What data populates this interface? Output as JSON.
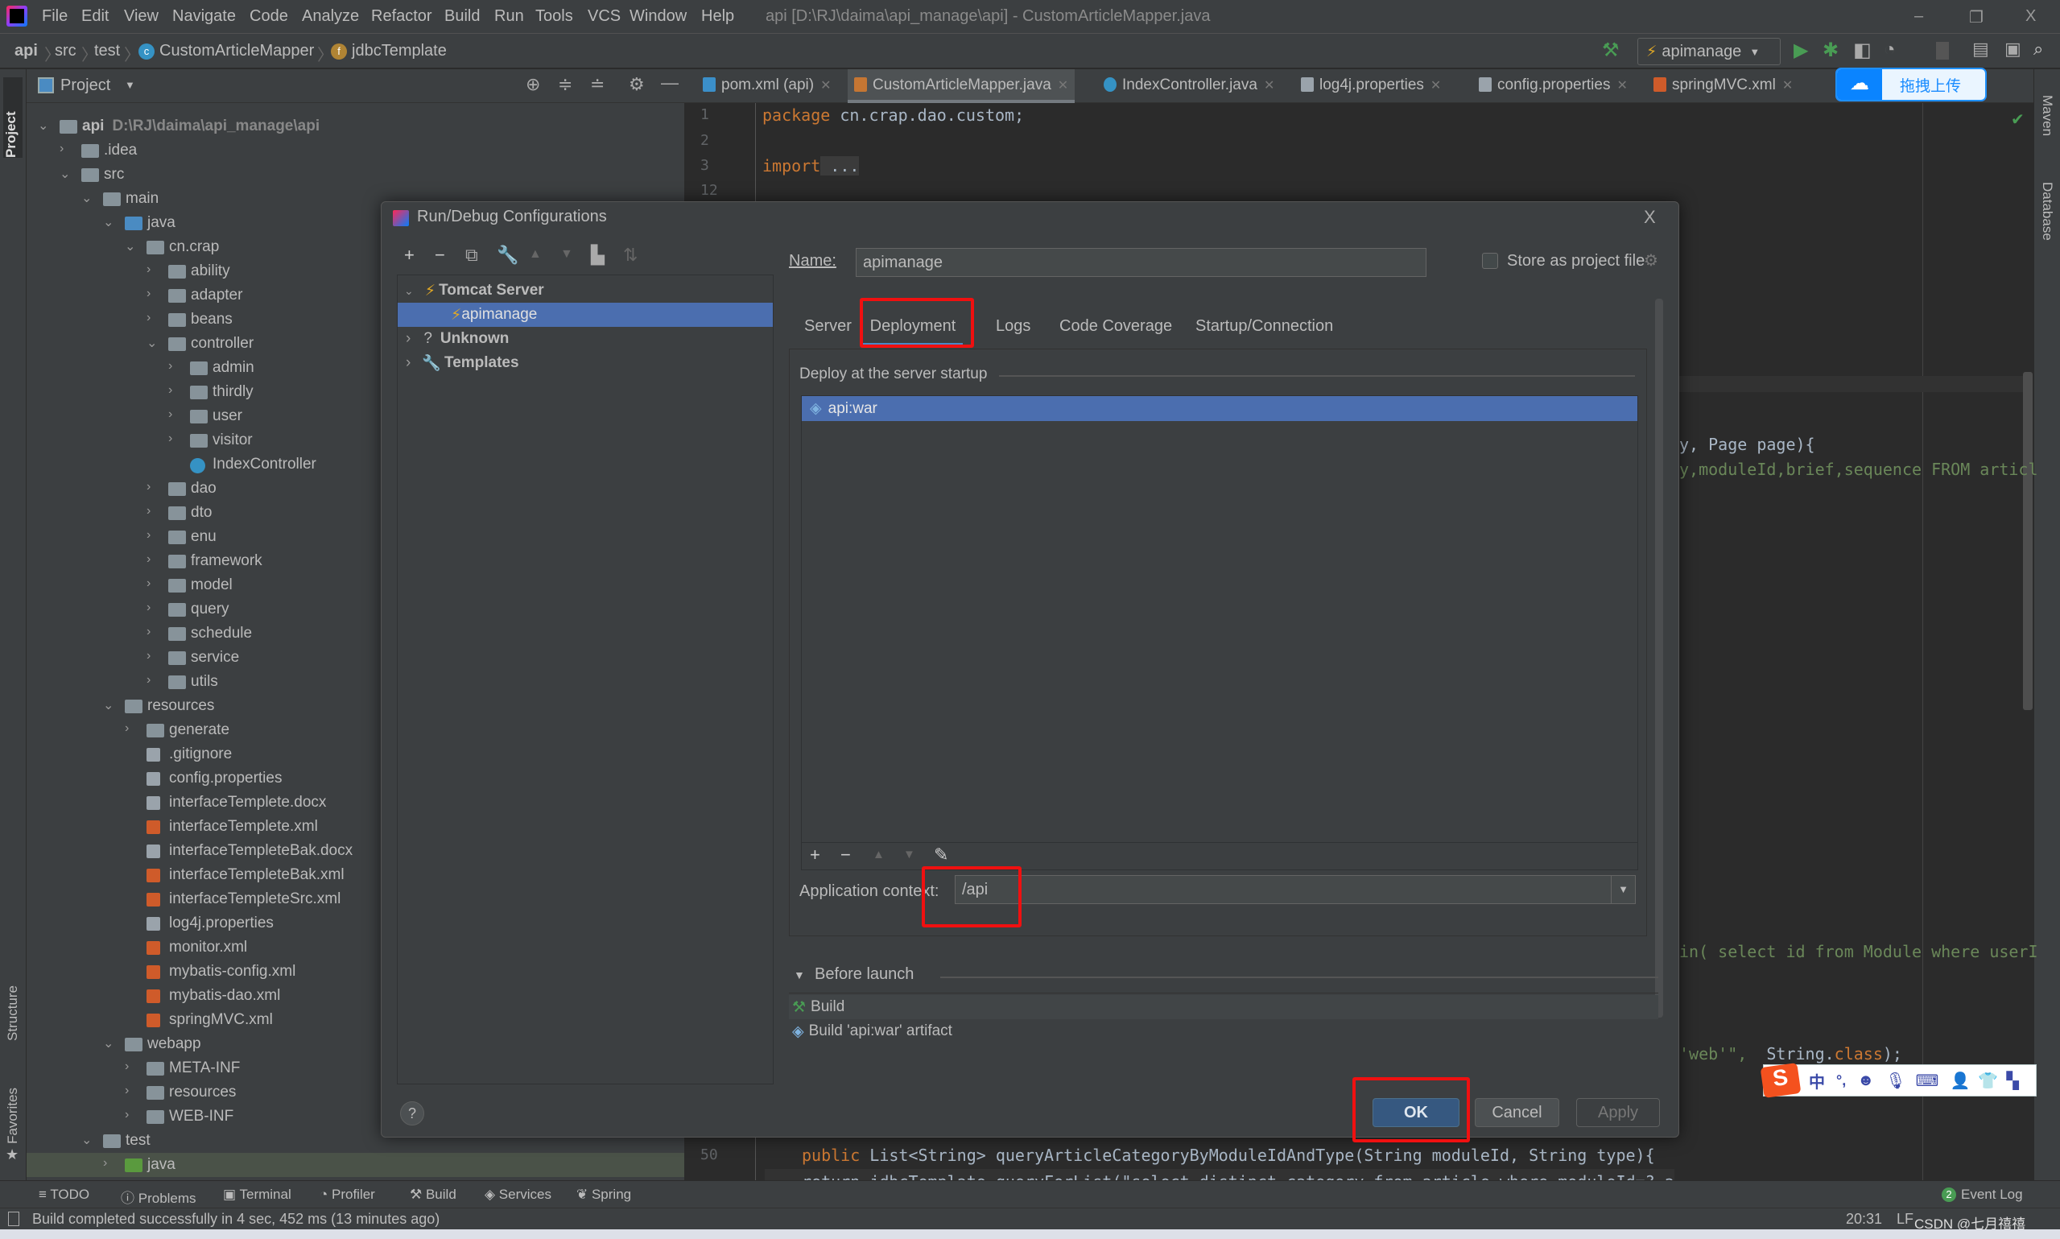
{
  "window": {
    "title": "api [D:\\RJ\\daima\\api_manage\\api] - CustomArticleMapper.java",
    "minimize": "–",
    "restore": "❐",
    "close": "X"
  },
  "menu": [
    "File",
    "Edit",
    "View",
    "Navigate",
    "Code",
    "Analyze",
    "Refactor",
    "Build",
    "Run",
    "Tools",
    "VCS",
    "Window",
    "Help"
  ],
  "breadcrumb": [
    "api",
    "src",
    "test",
    "CustomArticleMapper",
    "jdbcTemplate"
  ],
  "toolbar": {
    "run_config": "apimanage"
  },
  "upload_widget": {
    "label": "拖拽上传"
  },
  "left_stripe": {
    "project": "Project",
    "structure": "Structure",
    "favorites": "Favorites"
  },
  "right_stripe": {
    "maven": "Maven",
    "database": "Database"
  },
  "project_panel": {
    "title": "Project"
  },
  "tree": [
    {
      "label": "api",
      "hint": "D:\\RJ\\daima\\api_manage\\api",
      "level": 0,
      "exp": true,
      "type": "module"
    },
    {
      "label": ".idea",
      "level": 1,
      "exp": false,
      "type": "folder"
    },
    {
      "label": "src",
      "level": 1,
      "exp": true,
      "type": "folder"
    },
    {
      "label": "main",
      "level": 2,
      "exp": true,
      "type": "folder"
    },
    {
      "label": "java",
      "level": 3,
      "exp": true,
      "type": "src"
    },
    {
      "label": "cn.crap",
      "level": 4,
      "exp": true,
      "type": "folder"
    },
    {
      "label": "ability",
      "level": 5,
      "exp": false,
      "type": "folder"
    },
    {
      "label": "adapter",
      "level": 5,
      "exp": false,
      "type": "folder"
    },
    {
      "label": "beans",
      "level": 5,
      "exp": false,
      "type": "folder"
    },
    {
      "label": "controller",
      "level": 5,
      "exp": true,
      "type": "folder"
    },
    {
      "label": "admin",
      "level": 6,
      "exp": false,
      "type": "folder"
    },
    {
      "label": "thirdly",
      "level": 6,
      "exp": false,
      "type": "folder"
    },
    {
      "label": "user",
      "level": 6,
      "exp": false,
      "type": "folder"
    },
    {
      "label": "visitor",
      "level": 6,
      "exp": false,
      "type": "folder"
    },
    {
      "label": "IndexController",
      "level": 6,
      "exp": null,
      "type": "class"
    },
    {
      "label": "dao",
      "level": 5,
      "exp": false,
      "type": "folder"
    },
    {
      "label": "dto",
      "level": 5,
      "exp": false,
      "type": "folder"
    },
    {
      "label": "enu",
      "level": 5,
      "exp": false,
      "type": "folder"
    },
    {
      "label": "framework",
      "level": 5,
      "exp": false,
      "type": "folder"
    },
    {
      "label": "model",
      "level": 5,
      "exp": false,
      "type": "folder"
    },
    {
      "label": "query",
      "level": 5,
      "exp": false,
      "type": "folder"
    },
    {
      "label": "schedule",
      "level": 5,
      "exp": false,
      "type": "folder"
    },
    {
      "label": "service",
      "level": 5,
      "exp": false,
      "type": "folder"
    },
    {
      "label": "utils",
      "level": 5,
      "exp": false,
      "type": "folder"
    },
    {
      "label": "resources",
      "level": 3,
      "exp": true,
      "type": "res"
    },
    {
      "label": "generate",
      "level": 4,
      "exp": false,
      "type": "folder"
    },
    {
      "label": ".gitignore",
      "level": 4,
      "exp": null,
      "type": "file"
    },
    {
      "label": "config.properties",
      "level": 4,
      "exp": null,
      "type": "props"
    },
    {
      "label": "interfaceTemplete.docx",
      "level": 4,
      "exp": null,
      "type": "file"
    },
    {
      "label": "interfaceTemplete.xml",
      "level": 4,
      "exp": null,
      "type": "xml"
    },
    {
      "label": "interfaceTempleteBak.docx",
      "level": 4,
      "exp": null,
      "type": "file"
    },
    {
      "label": "interfaceTempleteBak.xml",
      "level": 4,
      "exp": null,
      "type": "xml"
    },
    {
      "label": "interfaceTempleteSrc.xml",
      "level": 4,
      "exp": null,
      "type": "xml"
    },
    {
      "label": "log4j.properties",
      "level": 4,
      "exp": null,
      "type": "props"
    },
    {
      "label": "monitor.xml",
      "level": 4,
      "exp": null,
      "type": "xml"
    },
    {
      "label": "mybatis-config.xml",
      "level": 4,
      "exp": null,
      "type": "xml"
    },
    {
      "label": "mybatis-dao.xml",
      "level": 4,
      "exp": null,
      "type": "xml"
    },
    {
      "label": "springMVC.xml",
      "level": 4,
      "exp": null,
      "type": "xml"
    },
    {
      "label": "webapp",
      "level": 3,
      "exp": true,
      "type": "web"
    },
    {
      "label": "META-INF",
      "level": 4,
      "exp": false,
      "type": "folder"
    },
    {
      "label": "resources",
      "level": 4,
      "exp": false,
      "type": "folder"
    },
    {
      "label": "WEB-INF",
      "level": 4,
      "exp": false,
      "type": "folder"
    },
    {
      "label": "test",
      "level": 2,
      "exp": true,
      "type": "folder"
    },
    {
      "label": "java",
      "level": 3,
      "exp": false,
      "type": "test",
      "selected": true
    },
    {
      "label": "resources",
      "level": 3,
      "exp": false,
      "type": "folder"
    }
  ],
  "editor_tabs": [
    {
      "label": "pom.xml (api)",
      "icon": "maven-icon"
    },
    {
      "label": "CustomArticleMapper.java",
      "icon": "java-file-icon",
      "active": true
    },
    {
      "label": "IndexController.java",
      "icon": "class-icon"
    },
    {
      "label": "log4j.properties",
      "icon": "properties-icon"
    },
    {
      "label": "config.properties",
      "icon": "properties-icon"
    },
    {
      "label": "springMVC.xml",
      "icon": "spring-xml-icon"
    }
  ],
  "code": {
    "line_numbers": [
      "1",
      "2",
      "3",
      "12",
      "50",
      "51"
    ],
    "l1_kw": "package",
    "l1_rest": " cn.crap.dao.custom;",
    "l3_kw": "import",
    "l3_rest": " ...",
    "r1": "y, Page page){",
    "r2": "y,moduleId,brief,sequence FROM articl",
    "r3": "in( select id from Module where userI",
    "r4a": "'web'\",",
    "r4b": "  String.",
    "r4c": "class",
    "r4d": ");",
    "l50_kw": "public",
    "l50_rest": " List<String> queryArticleCategoryByModuleIdAndType(String moduleId, String type){",
    "l51": "return jdbcTemplate.queryForList(\"select distinct category from article where moduleId=? and type=?\", new Object[]{moduleId"
  },
  "dialog": {
    "title": "Run/Debug Configurations",
    "close": "X",
    "tree": [
      {
        "label": "Tomcat Server",
        "bold": true
      },
      {
        "label": "apimanage",
        "selected": true
      },
      {
        "label": "Unknown",
        "bold": true
      },
      {
        "label": "Templates",
        "bold": true
      }
    ],
    "name_label": "Name:",
    "name_value": "apimanage",
    "store_label": "Store as project file",
    "store_checked": false,
    "tabs": [
      "Server",
      "Deployment",
      "Logs",
      "Code Coverage",
      "Startup/Connection"
    ],
    "active_tab": "Deployment",
    "deploy_title": "Deploy at the server startup",
    "artifacts": [
      "api:war"
    ],
    "app_context_label": "Application context:",
    "app_context_value": "/api",
    "before_launch_label": "Before launch",
    "before_launch_items": [
      "Build",
      "Build 'api:war' artifact"
    ],
    "help": "?",
    "ok": "OK",
    "cancel": "Cancel",
    "apply": "Apply"
  },
  "bottom_tools": [
    "TODO",
    "Problems",
    "Terminal",
    "Profiler",
    "Build",
    "Services",
    "Spring"
  ],
  "event_log": {
    "count": "2",
    "label": "Event Log"
  },
  "status": {
    "message": "Build completed successfully in 4 sec, 452 ms (13 minutes ago)",
    "time": "20:31",
    "line_sep": "LF",
    "watermark": "CSDN @七月禧禧"
  },
  "ime": {
    "cn": "中",
    "punct": "°,"
  },
  "colors": {
    "accent": "#4b6eaf",
    "highlight": "#f01010",
    "ok_button": "#365880",
    "background": "#3c3f41",
    "editor": "#2b2b2b"
  }
}
